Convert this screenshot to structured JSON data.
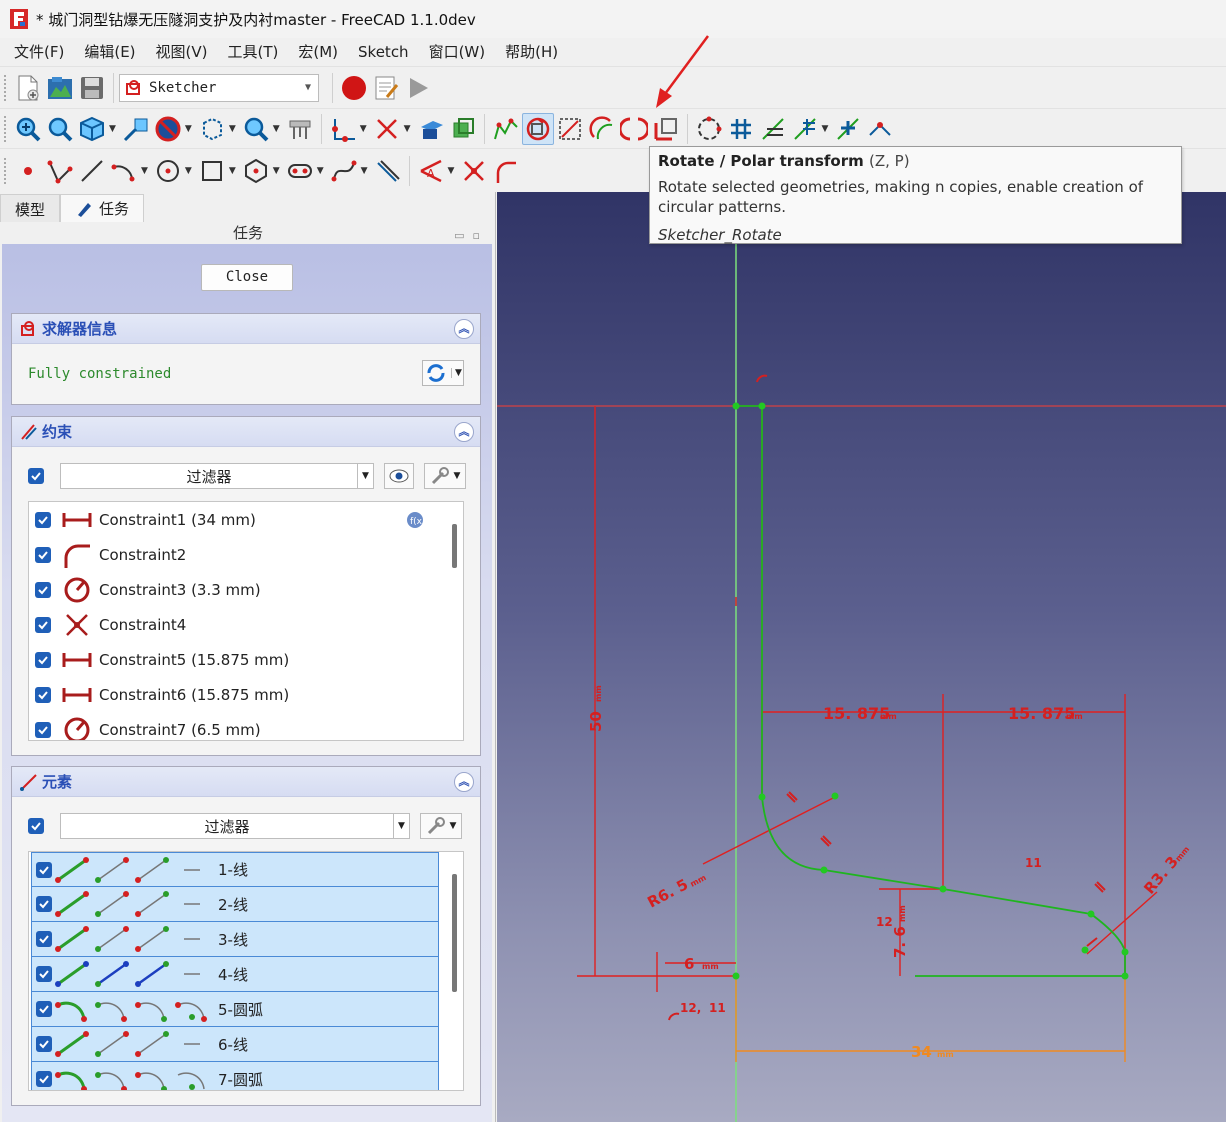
{
  "window": {
    "title": "* 城门洞型钻爆无压隧洞支护及内衬master - FreeCAD 1.1.0dev"
  },
  "menu": [
    "文件(F)",
    "编辑(E)",
    "视图(V)",
    "工具(T)",
    "宏(M)",
    "Sketch",
    "窗口(W)",
    "帮助(H)"
  ],
  "toolbar": {
    "workbench": "Sketcher"
  },
  "tooltip": {
    "title": "Rotate / Polar transform",
    "shortcut": "(Z, P)",
    "description": "Rotate selected geometries, making n copies, enable creation of circular patterns.",
    "command": "Sketcher_Rotate"
  },
  "left_panel": {
    "tabs": [
      "模型",
      "任务"
    ],
    "header": "任务",
    "close_label": "Close",
    "solver": {
      "title": "求解器信息",
      "status": "Fully constrained"
    },
    "constraints": {
      "title": "约束",
      "filter": "过滤器",
      "items": [
        {
          "label": "Constraint1 (34 mm)",
          "kind": "distance-horizontal-icon"
        },
        {
          "label": "Constraint2",
          "kind": "tangent-icon"
        },
        {
          "label": "Constraint3 (3.3 mm)",
          "kind": "radius-icon"
        },
        {
          "label": "Constraint4",
          "kind": "symmetric-icon"
        },
        {
          "label": "Constraint5 (15.875 mm)",
          "kind": "distance-horizontal-icon"
        },
        {
          "label": "Constraint6 (15.875 mm)",
          "kind": "distance-horizontal-icon"
        },
        {
          "label": "Constraint7 (6.5 mm)",
          "kind": "radius-icon"
        }
      ]
    },
    "elements": {
      "title": "元素",
      "filter": "过滤器",
      "items": [
        {
          "label": "1-线",
          "type": "line"
        },
        {
          "label": "2-线",
          "type": "line"
        },
        {
          "label": "3-线",
          "type": "line"
        },
        {
          "label": "4-线",
          "type": "construction-line"
        },
        {
          "label": "5-圆弧",
          "type": "arc"
        },
        {
          "label": "6-线",
          "type": "line"
        },
        {
          "label": "7-圆弧",
          "type": "arc"
        }
      ]
    }
  },
  "sketch": {
    "dimensions": {
      "d50": "50",
      "d15a": "15. 875",
      "d15b": "15. 875",
      "r65": "R6. 5",
      "r33": "R3. 3",
      "d6": "6",
      "d76": "7. 6",
      "d34": "34",
      "c11": "11",
      "c12": "12",
      "c1211a": "12,",
      "c1211b": "11",
      "unit": "mm"
    }
  },
  "colors": {
    "constraint": "#d42020",
    "geometry": "#1f9e1f",
    "vertex": "#27c427",
    "accent": "#2a4fb6"
  }
}
